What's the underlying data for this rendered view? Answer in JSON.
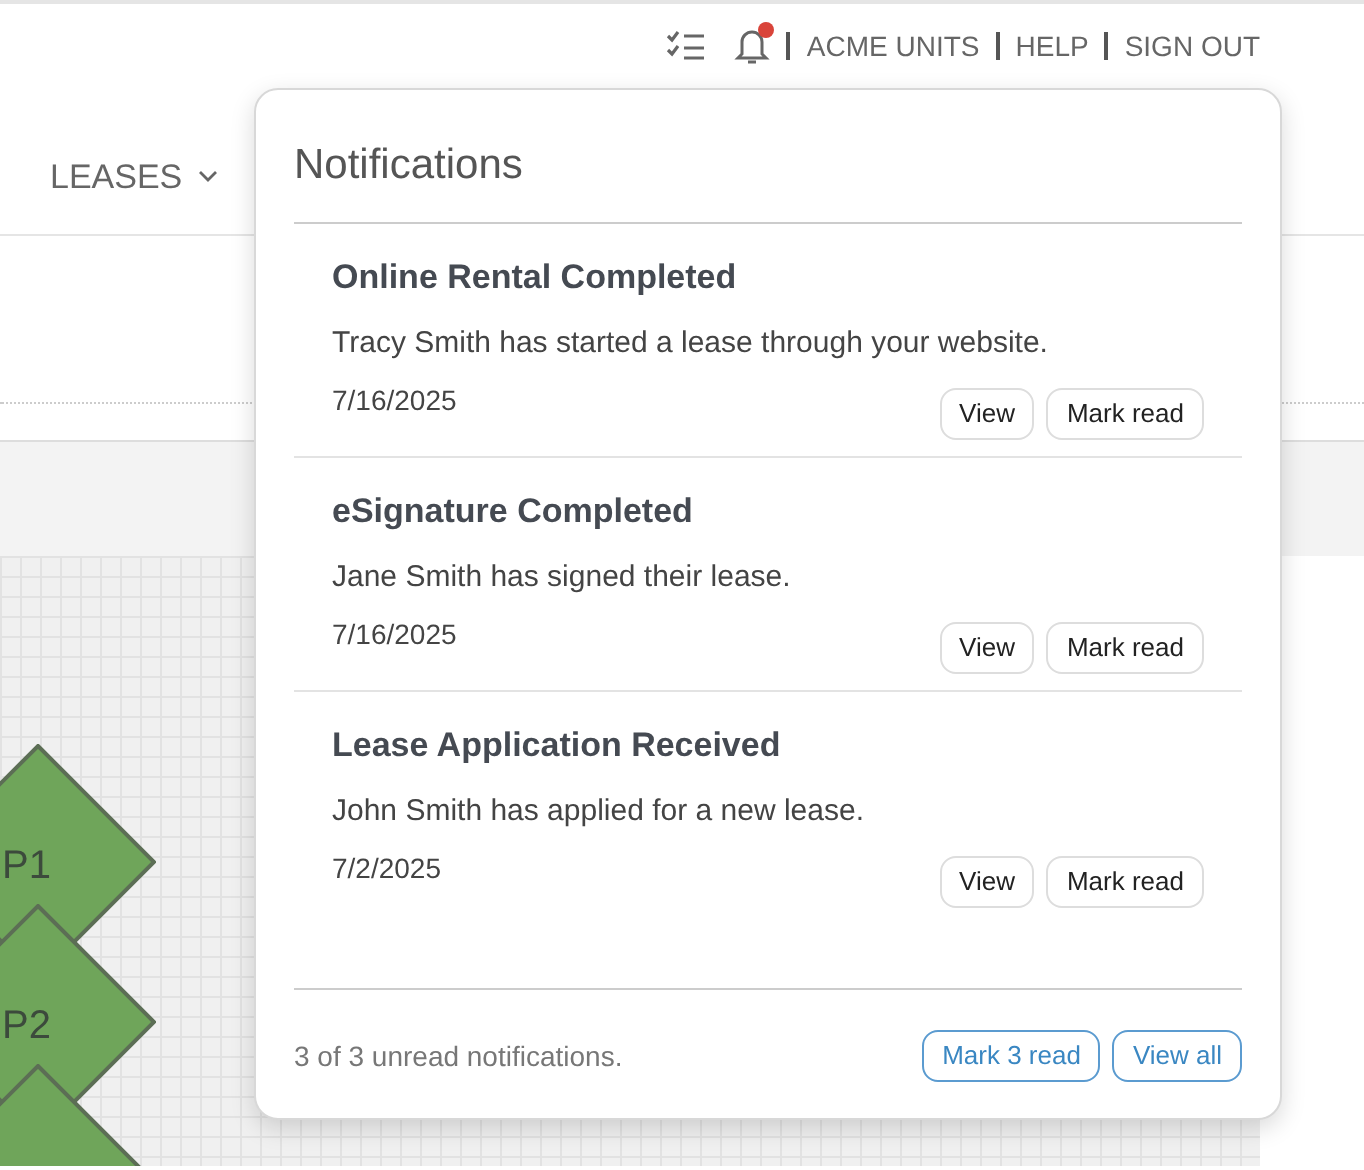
{
  "header": {
    "links": [
      "ACME UNITS",
      "HELP",
      "SIGN OUT"
    ],
    "bell_unread": true
  },
  "nav": {
    "items": [
      {
        "label": "LEASES"
      }
    ]
  },
  "canvas": {
    "nodes": [
      {
        "kind": "diamond",
        "label": "P1"
      },
      {
        "kind": "diamond",
        "label": "P2"
      },
      {
        "kind": "diamond"
      }
    ]
  },
  "notifications": {
    "title": "Notifications",
    "items": [
      {
        "title": "Online Rental Completed",
        "message": "Tracy Smith has started a lease through your website.",
        "date": "7/16/2025",
        "actions": [
          "View",
          "Mark read"
        ]
      },
      {
        "title": "eSignature Completed",
        "message": "Jane Smith has signed their lease.",
        "date": "7/16/2025",
        "actions": [
          "View",
          "Mark read"
        ]
      },
      {
        "title": "Lease Application Received",
        "message": "John Smith has applied for a new lease.",
        "date": "7/2/2025",
        "actions": [
          "View",
          "Mark read"
        ]
      }
    ],
    "summary": "3 of 3 unread notifications.",
    "footer_buttons": [
      "Mark 3 read",
      "View all"
    ]
  }
}
